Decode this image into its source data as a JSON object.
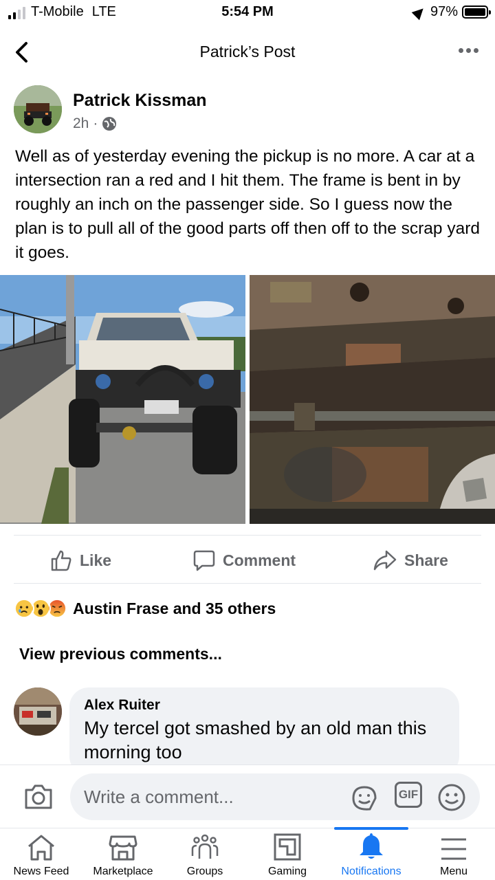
{
  "status_bar": {
    "carrier": "T-Mobile",
    "network": "LTE",
    "time": "5:54 PM",
    "battery": "97%"
  },
  "header": {
    "title": "Patrick’s Post"
  },
  "post": {
    "author": "Patrick Kissman",
    "time": "2h",
    "separator": "·",
    "privacy_icon": "globe-icon",
    "text": "Well as of yesterday evening the pickup is no more. A car at a intersection ran a red and I hit them. The frame is bent in by roughly an inch on the passenger side. So I guess now the plan is to pull all of the good parts off then off to the scrap yard it goes."
  },
  "actions": {
    "like": "Like",
    "comment": "Comment",
    "share": "Share"
  },
  "reactions": {
    "summary": "Austin Frase and 35 others",
    "icons": [
      "sad",
      "wow",
      "angry"
    ]
  },
  "comments": {
    "view_previous": "View previous comments...",
    "items": [
      {
        "name": "Alex Ruiter",
        "text": "My tercel got smashed by an old man this morning too"
      }
    ]
  },
  "composer": {
    "placeholder": "Write a comment...",
    "gif": "GIF"
  },
  "tabbar": {
    "items": [
      {
        "label": "News Feed"
      },
      {
        "label": "Marketplace"
      },
      {
        "label": "Groups"
      },
      {
        "label": "Gaming"
      },
      {
        "label": "Notifications",
        "active": true
      },
      {
        "label": "Menu"
      }
    ]
  },
  "colors": {
    "accent": "#1877f2",
    "secondary_text": "#65676b",
    "bubble": "#f0f2f5"
  }
}
